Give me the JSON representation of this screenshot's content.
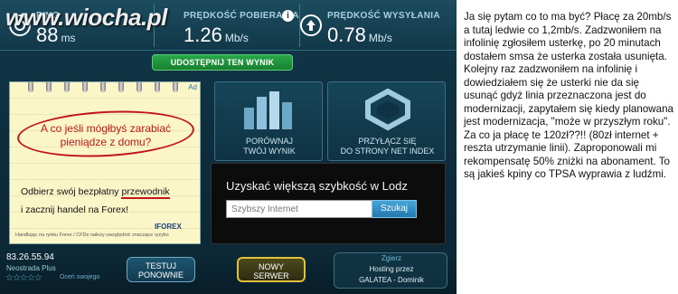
{
  "watermark": "www.wiocha.pl",
  "stats": {
    "ping": {
      "title": "PING",
      "value": "88",
      "unit": "ms",
      "icon": "ping-icon"
    },
    "download": {
      "title": "PRĘDKOŚĆ POBIERANIA",
      "value": "1.26",
      "unit": "Mb/s",
      "icon": "download-arrow-icon"
    },
    "upload": {
      "title": "PRĘDKOŚĆ WYSYŁANIA",
      "value": "0.78",
      "unit": "Mb/s",
      "icon": "upload-arrow-icon"
    }
  },
  "share_button": "UDOSTĘPNIJ TEN WYNIK",
  "ad": {
    "corner_label": "Ad",
    "headline": "A co jeśli mógłbyś zarabiać pieniądze z domu?",
    "line1_prefix": "Odbierz swój bezpłatny ",
    "line1_underlined": "przewodnik",
    "line2": "i zacznij handel na Forex!",
    "logo": "IFOREX",
    "disclaimer": "Handlując na rynku Forex / CFDs należy uwzględnić znaczące ryzyko"
  },
  "panels": {
    "compare": {
      "line1": "PORÓWNAJ",
      "line2": "TWÓJ WYNIK"
    },
    "join": {
      "line1": "PRZYŁĄCZ SIĘ",
      "line2": "DO STRONY NET INDEX"
    }
  },
  "isp_box": {
    "title": "Uzyskać większą szybkość w Lodz",
    "input_placeholder": "Szybszy Internet",
    "button": "Szukaj"
  },
  "bottom": {
    "ip": "83.26.55.94",
    "isp": "Neostrada Plus",
    "rating_stars": "☆☆☆☆☆",
    "rate_link": "Oceń swojego",
    "retest_line1": "TESTUJ",
    "retest_line2": "PONOWNIE",
    "newserver_line1": "NOWY",
    "newserver_line2": "SERWER",
    "host_city": "Zgierz",
    "host_line1": "Hosting przez",
    "host_line2": "GALATEA - Dominik"
  },
  "colors": {
    "accent_green": "#28a84a",
    "ad_red": "#c0161d",
    "panel_blue": "#164558"
  },
  "story": "Ja się pytam co to ma być? Płacę za 20mb/s a tutaj ledwie co 1,2mb/s. Zadzwoniłem na infolinię zgłosiłem usterkę, po 20 minutach dostałem smsa że usterka została usunięta. Kolejny raz zadzwoniłem na infolinię i dowiedziałem się że usterki nie da się usunąć gdyż linia przeznaczona jest do modernizacji, zapytałem się kiedy planowana jest modernizacja, \"może w przyszłym roku\". Za co ja płacę te 120zł??!! (80zł internet + reszta utrzymanie linii). Zaproponowali mi rekompensatę 50% zniżki na abonament. To są jakieś kpiny co TPSA wyprawia z ludźmi."
}
